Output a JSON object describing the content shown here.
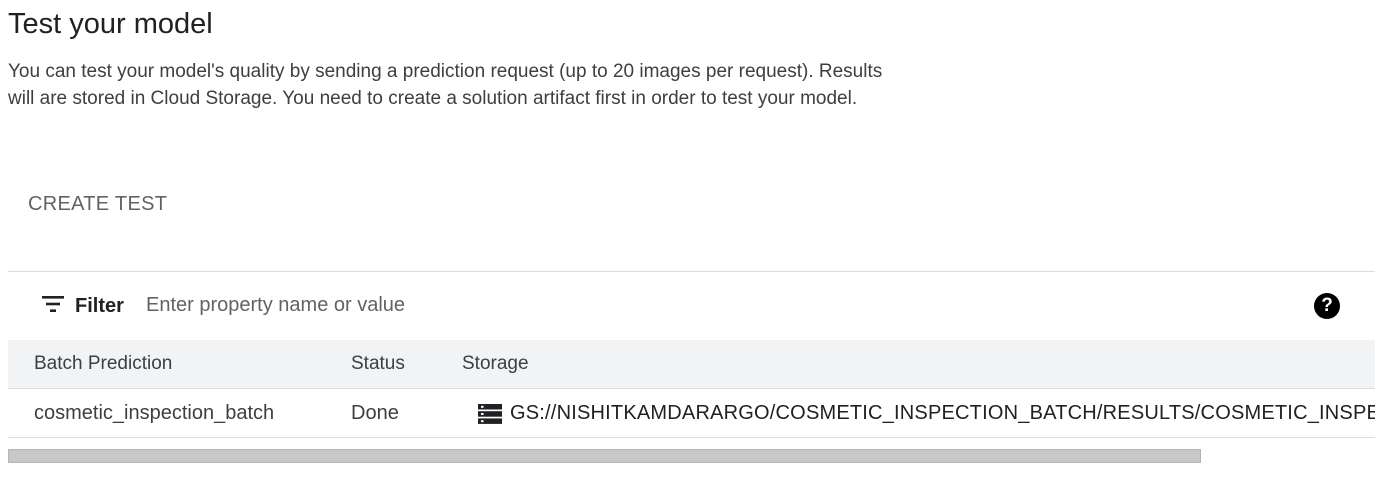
{
  "header": {
    "title": "Test your model",
    "description": "You can test your model's quality by sending a prediction request (up to 20 images per request). Results will are stored in Cloud Storage. You need to create a solution artifact first in order to test your model."
  },
  "actions": {
    "create_test_label": "CREATE TEST"
  },
  "filter": {
    "label": "Filter",
    "placeholder": "Enter property name or value",
    "value": "",
    "icon": "filter-list-icon",
    "help_icon": "help-icon",
    "help_glyph": "?"
  },
  "table": {
    "columns": [
      "Batch Prediction",
      "Status",
      "Storage"
    ],
    "rows": [
      {
        "batch_prediction": "cosmetic_inspection_batch",
        "status": "Done",
        "storage": "GS://NISHITKAMDARARGO/COSMETIC_INSPECTION_BATCH/RESULTS/COSMETIC_INSPECTION_BATCH",
        "storage_icon": "storage-bucket-icon"
      }
    ]
  },
  "colors": {
    "text_primary": "#202124",
    "text_secondary": "#5f6368",
    "header_bg": "#f1f3f4",
    "divider": "#dadce0",
    "scrollbar": "#c8c8c8"
  }
}
